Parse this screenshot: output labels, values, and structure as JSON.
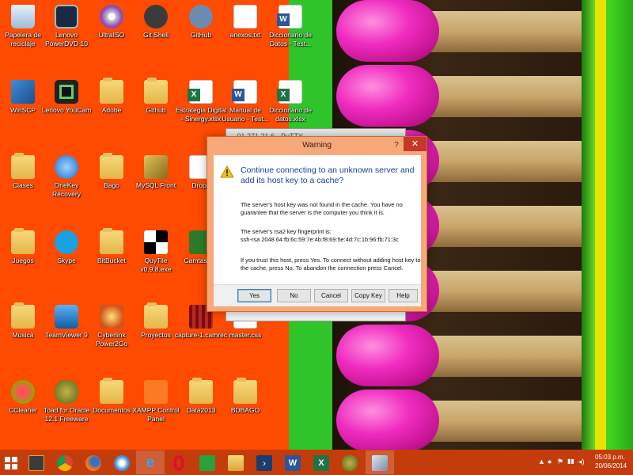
{
  "colors": {
    "wallpaper_orange": "#ff4a02",
    "taskbar": "#c53c0c",
    "dialog_frame": "#f8a878",
    "close_button": "#c7362b",
    "heading_blue": "#1b3f9e"
  },
  "desktop_icons": [
    {
      "label": "Papelera de reciclaje",
      "icon": "recycle-bin-icon"
    },
    {
      "label": "Lenovo PowerDVD 10",
      "icon": "powerdvd-icon"
    },
    {
      "label": "UltraISO",
      "icon": "ultraiso-icon"
    },
    {
      "label": "Git Shell",
      "icon": "git-shell-icon"
    },
    {
      "label": "GitHub",
      "icon": "github-icon"
    },
    {
      "label": "anexos.txt",
      "icon": "text-file-icon"
    },
    {
      "label": "Diccionario de Datos - Test...",
      "icon": "word-document-icon"
    },
    {
      "label": "WinSCP",
      "icon": "winscp-icon"
    },
    {
      "label": "Lenovo YouCam",
      "icon": "youcam-icon"
    },
    {
      "label": "Adobe",
      "icon": "folder-icon"
    },
    {
      "label": "Github",
      "icon": "folder-icon"
    },
    {
      "label": "Estrategia Digital - Sinergy.xlsx",
      "icon": "excel-document-icon"
    },
    {
      "label": "Manual de Usuario - Test...",
      "icon": "word-document-icon"
    },
    {
      "label": "Diccionario de datos.xlsx",
      "icon": "excel-document-icon"
    },
    {
      "label": "Clases",
      "icon": "folder-icon"
    },
    {
      "label": "OneKey Recovery",
      "icon": "onekey-recovery-icon"
    },
    {
      "label": "Bago",
      "icon": "folder-icon"
    },
    {
      "label": "MySQL Front",
      "icon": "mysql-front-icon"
    },
    {
      "label": "Dropb",
      "icon": "dropbox-icon"
    },
    {
      "label": "Juegos",
      "icon": "folder-icon"
    },
    {
      "label": "Skype",
      "icon": "skype-icon"
    },
    {
      "label": "BitBucket",
      "icon": "folder-icon"
    },
    {
      "label": "QuyTile v0.9.8.exe",
      "icon": "qtile-icon"
    },
    {
      "label": "Camtasia 8",
      "icon": "camtasia-icon"
    },
    {
      "label": "Musica",
      "icon": "folder-icon"
    },
    {
      "label": "TeamViewer 9",
      "icon": "teamviewer-icon"
    },
    {
      "label": "Cyberlink Power2Go",
      "icon": "power2go-icon"
    },
    {
      "label": "Proyectos",
      "icon": "folder-icon"
    },
    {
      "label": "capture-1.camrec",
      "icon": "video-file-icon"
    },
    {
      "label": "master.css",
      "icon": "css-file-icon"
    },
    {
      "label": "CCleaner",
      "icon": "ccleaner-icon"
    },
    {
      "label": "Toad for Oracle 12.1 Freeware",
      "icon": "toad-icon"
    },
    {
      "label": "Documentos",
      "icon": "folder-icon"
    },
    {
      "label": "XAMPP Control Panel",
      "icon": "xampp-icon"
    },
    {
      "label": "Data2013",
      "icon": "folder-icon"
    },
    {
      "label": "BDBAGO",
      "icon": "folder-icon"
    }
  ],
  "background_window": {
    "title": "...01.271.21.6 - PuTTY ..."
  },
  "dialog": {
    "title": "Warning",
    "help_glyph": "?",
    "close_glyph": "✕",
    "heading": "Continue connecting to an unknown server and add its host key to a cache?",
    "p1": "The server's host key was not found in the cache. You have no guarantee that the server is the computer you think it is.",
    "p2_label": "The server's rsa2 key fingerprint is:",
    "p2_value": "ssh-rsa 2048 64:fb:6c:59:7e:4b:f8:69:5e:4d:7c:1b:96:fb:71:3c",
    "p3": "If you trust this host, press Yes. To connect without adding host key to the cache, press No. To abandon the connection press Cancel.",
    "buttons": {
      "yes": "Yes",
      "no": "No",
      "cancel": "Cancel",
      "copy_key": "Copy Key",
      "help": "Help"
    }
  },
  "taskbar": {
    "pinned": [
      {
        "name": "sublime-text-icon"
      },
      {
        "name": "chrome-icon"
      },
      {
        "name": "firefox-icon"
      },
      {
        "name": "safari-icon"
      },
      {
        "name": "internet-explorer-icon"
      },
      {
        "name": "opera-icon"
      },
      {
        "name": "store-icon"
      },
      {
        "name": "file-explorer-icon"
      },
      {
        "name": "powershell-icon"
      },
      {
        "name": "word-icon"
      },
      {
        "name": "excel-icon"
      },
      {
        "name": "toad-icon"
      },
      {
        "name": "putty-icon"
      }
    ],
    "clock_time": "05:03 p.m.",
    "clock_date": "20/06/2014"
  }
}
